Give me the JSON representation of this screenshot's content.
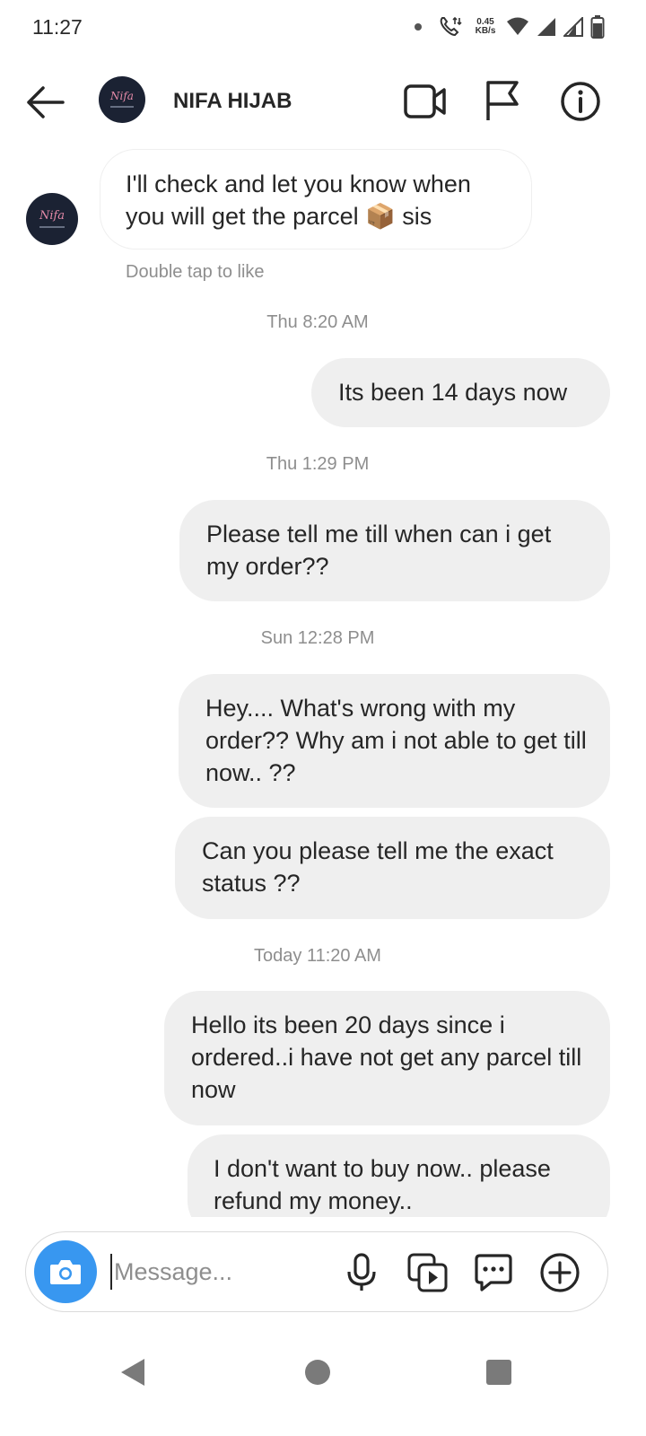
{
  "status_bar": {
    "time": "11:27",
    "speed_value": "0.45",
    "speed_unit": "KB/s",
    "icons": [
      "dot-icon",
      "call-icon",
      "wifi-icon",
      "signal-icon",
      "signal-icon",
      "battery-icon"
    ]
  },
  "header": {
    "title": "NIFA HIJAB",
    "avatar_text": "Nifa",
    "icons": [
      "back-arrow-icon",
      "video-camera-icon",
      "flag-icon",
      "info-icon"
    ]
  },
  "conversation": {
    "incoming": {
      "text": "I'll check and let you know when you will get the parcel 📦 sis",
      "hint": "Double tap to like"
    },
    "timestamps": [
      "Thu 8:20 AM",
      "Thu 1:29 PM",
      "Sun 12:28 PM",
      "Today 11:20 AM"
    ],
    "outgoing": [
      "Its been 14 days now",
      "Please tell me till when can i get my order??",
      "Hey.... What's wrong with my order?? Why am i not able to get till now.. ??",
      "Can you please tell me the exact status ??",
      "Hello its been 20 days since i ordered..i have not get any parcel till now",
      "I don't want to buy now.. please refund my money.."
    ]
  },
  "composer": {
    "placeholder": "Message...",
    "icons": [
      "camera-icon",
      "microphone-icon",
      "gallery-icon",
      "sticker-icon",
      "plus-icon"
    ]
  },
  "colors": {
    "accent": "#3897f0",
    "outgoing_bubble": "#efefef",
    "muted_text": "#8e8e8e",
    "avatar_bg": "#1b2233",
    "avatar_script": "#e58aa8"
  }
}
